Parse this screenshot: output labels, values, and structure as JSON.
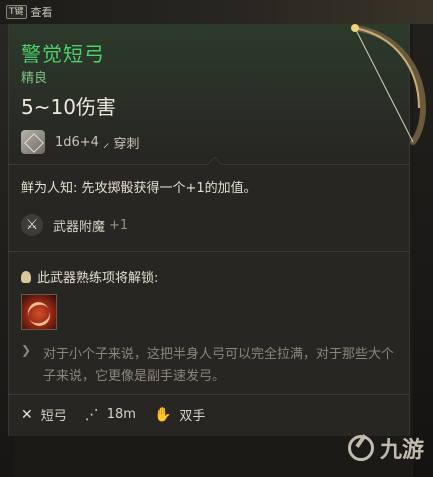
{
  "top_hint": {
    "key": "T键",
    "label": "查看"
  },
  "item": {
    "name": "警觉短弓",
    "rarity": "精良",
    "damage": "5~10伤害",
    "dice": "1d6+4",
    "damage_type": "穿刺",
    "colors": {
      "title": "#4dd06a",
      "rarity": "#7fbf83"
    }
  },
  "passive": {
    "text": "鲜为人知: 先攻掷骰获得一个+1的加值。"
  },
  "enchant": {
    "label": "武器附魔",
    "value": "+1"
  },
  "proficiency": {
    "label": "此武器熟练项将解锁:"
  },
  "flavor": "对于小个子来说，这把半身人弓可以完全拉满，对于那些大个子来说，它更像是副手速发弓。",
  "properties": [
    {
      "icon": "bow-type-icon",
      "label": "短弓"
    },
    {
      "icon": "range-icon",
      "label": "18m"
    },
    {
      "icon": "hand-icon",
      "label": "双手"
    }
  ],
  "watermark": {
    "text": "九游"
  }
}
